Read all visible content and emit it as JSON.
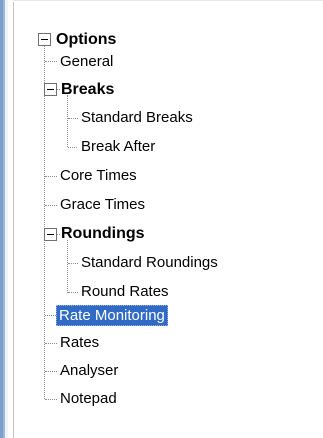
{
  "tree": {
    "options": "Options",
    "general": "General",
    "breaks": "Breaks",
    "standard_breaks": "Standard Breaks",
    "break_after": "Break After",
    "core_times": "Core Times",
    "grace_times": "Grace Times",
    "roundings": "Roundings",
    "standard_roundings": "Standard Roundings",
    "round_rates": "Round Rates",
    "rate_monitoring": "Rate Monitoring",
    "rates": "Rates",
    "analyser": "Analyser",
    "notepad": "Notepad"
  },
  "selected_item": "Rate Monitoring",
  "colors": {
    "selection": "#316ac5",
    "connector": "#8c8c8c"
  }
}
